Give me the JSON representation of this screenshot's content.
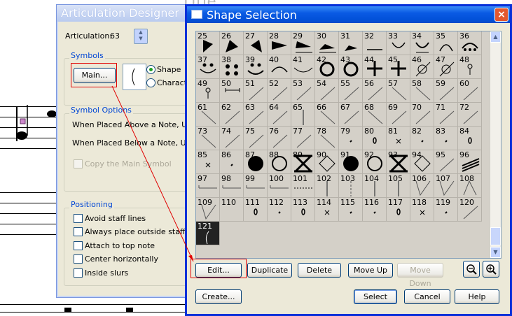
{
  "background": {
    "brand_color": "#cc88cc"
  },
  "articulation_dialog": {
    "title": "Articulation Designer",
    "articulation_label": "Articulation:",
    "articulation_value": "63",
    "symbols_group": "Symbols",
    "main_button": "Main...",
    "shape_radio": "Shape",
    "character_radio": "Characte",
    "options_group": "Symbol Options",
    "above_label": "When Placed Above a Note, Use T",
    "below_label": "When Placed Below a Note, Use T",
    "copy_main": "Copy the Main Symbol",
    "positioning_group": "Positioning",
    "checkboxes": [
      "Avoid staff lines",
      "Always place outside staff",
      "Attach to top note",
      "Center horizontally",
      "Inside slurs"
    ]
  },
  "shape_dialog": {
    "title": "Shape Selection",
    "close_glyph": "×",
    "cells": [
      {
        "n": "25",
        "g": "tri-r"
      },
      {
        "n": "26",
        "g": "tri-r2"
      },
      {
        "n": "27",
        "g": "tri-l"
      },
      {
        "n": "28",
        "g": "wedge"
      },
      {
        "n": "29",
        "g": "wedge-line"
      },
      {
        "n": "30",
        "g": "wedge-flat"
      },
      {
        "n": "31",
        "g": "wedge-small"
      },
      {
        "n": "32",
        "g": "line"
      },
      {
        "n": "33",
        "g": "arc-up"
      },
      {
        "n": "34",
        "g": "arc-up2"
      },
      {
        "n": "35",
        "g": "arc-down"
      },
      {
        "n": "36",
        "g": "arc-dots"
      },
      {
        "n": "37",
        "g": "smile-dots"
      },
      {
        "n": "38",
        "g": "dots"
      },
      {
        "n": "39",
        "g": "smile"
      },
      {
        "n": "40",
        "g": "arc-down2"
      },
      {
        "n": "41",
        "g": "arc-flat"
      },
      {
        "n": "42",
        "g": "circle"
      },
      {
        "n": "43",
        "g": "circle"
      },
      {
        "n": "44",
        "g": "plus"
      },
      {
        "n": "45",
        "g": "plus"
      },
      {
        "n": "46",
        "g": "slash-circle"
      },
      {
        "n": "47",
        "g": "slash-circle"
      },
      {
        "n": "48",
        "g": "small-circle"
      },
      {
        "n": "49",
        "g": "small-circle"
      },
      {
        "n": "50",
        "g": "bar"
      },
      {
        "n": "51",
        "g": "diag"
      },
      {
        "n": "52",
        "g": "diag"
      },
      {
        "n": "53",
        "g": "diag"
      },
      {
        "n": "54",
        "g": "diag"
      },
      {
        "n": "55",
        "g": "diag"
      },
      {
        "n": "56",
        "g": "diag"
      },
      {
        "n": "57",
        "g": "diag2"
      },
      {
        "n": "58",
        "g": "diag2"
      },
      {
        "n": "59",
        "g": "diag"
      },
      {
        "n": "60",
        "g": "diag"
      },
      {
        "n": "61",
        "g": "diag2"
      },
      {
        "n": "62",
        "g": "diag"
      },
      {
        "n": "63",
        "g": "diag"
      },
      {
        "n": "64",
        "g": "diag"
      },
      {
        "n": "65",
        "g": "vert"
      },
      {
        "n": "66",
        "g": "diag2"
      },
      {
        "n": "67",
        "g": "diag"
      },
      {
        "n": "68",
        "g": "diag2"
      },
      {
        "n": "69",
        "g": "diag"
      },
      {
        "n": "70",
        "g": "diag"
      },
      {
        "n": "71",
        "g": "diag"
      },
      {
        "n": "72",
        "g": "diag"
      },
      {
        "n": "73",
        "g": "diag2"
      },
      {
        "n": "74",
        "g": "diag"
      },
      {
        "n": "75",
        "g": "diag"
      },
      {
        "n": "76",
        "g": "diag"
      },
      {
        "n": "77",
        "g": "diag"
      },
      {
        "n": "78",
        "g": "diag2"
      },
      {
        "n": "79",
        "g": "tiny"
      },
      {
        "n": "80",
        "g": "tiny-o"
      },
      {
        "n": "81",
        "g": "tiny-x"
      },
      {
        "n": "82",
        "g": "tiny"
      },
      {
        "n": "83",
        "g": "tiny"
      },
      {
        "n": "84",
        "g": "tiny-o"
      },
      {
        "n": "85",
        "g": "tiny-x"
      },
      {
        "n": "86",
        "g": "tiny"
      },
      {
        "n": "87",
        "g": "disc"
      },
      {
        "n": "88",
        "g": "ring"
      },
      {
        "n": "89",
        "g": "x"
      },
      {
        "n": "90",
        "g": "diamond"
      },
      {
        "n": "91",
        "g": "disc"
      },
      {
        "n": "92",
        "g": "ring"
      },
      {
        "n": "93",
        "g": "x"
      },
      {
        "n": "94",
        "g": "diamond"
      },
      {
        "n": "95",
        "g": "diag"
      },
      {
        "n": "96",
        "g": "hatch"
      },
      {
        "n": "97",
        "g": "ledger"
      },
      {
        "n": "98",
        "g": "ledger"
      },
      {
        "n": "99",
        "g": "ledger"
      },
      {
        "n": "100",
        "g": "ledger"
      },
      {
        "n": "101",
        "g": "dotted"
      },
      {
        "n": "102",
        "g": "vert"
      },
      {
        "n": "103",
        "g": "vert-dash"
      },
      {
        "n": "104",
        "g": "vert"
      },
      {
        "n": "105",
        "g": "vert"
      },
      {
        "n": "106",
        "g": "vee"
      },
      {
        "n": "107",
        "g": "vee"
      },
      {
        "n": "108",
        "g": "wedge-up"
      },
      {
        "n": "109",
        "g": "vee"
      },
      {
        "n": "110",
        "g": "none"
      },
      {
        "n": "111",
        "g": "tiny-o"
      },
      {
        "n": "112",
        "g": "tiny"
      },
      {
        "n": "113",
        "g": "tiny-o"
      },
      {
        "n": "114",
        "g": "tiny-x"
      },
      {
        "n": "115",
        "g": "tiny"
      },
      {
        "n": "116",
        "g": "tiny"
      },
      {
        "n": "117",
        "g": "tiny-o"
      },
      {
        "n": "118",
        "g": "tiny-x"
      },
      {
        "n": "119",
        "g": "tiny"
      },
      {
        "n": "120",
        "g": "diag"
      },
      {
        "n": "121",
        "g": "paren"
      }
    ],
    "selected_cell": "121",
    "buttons": {
      "edit": "Edit...",
      "duplicate": "Duplicate",
      "delete": "Delete",
      "move_up": "Move Up",
      "move_down": "Move Down",
      "create": "Create...",
      "select": "Select",
      "cancel": "Cancel",
      "help": "Help"
    },
    "zoom_out_icon": "zoom-out-icon",
    "zoom_in_icon": "zoom-in-icon",
    "highlight_color": "#e00000"
  }
}
